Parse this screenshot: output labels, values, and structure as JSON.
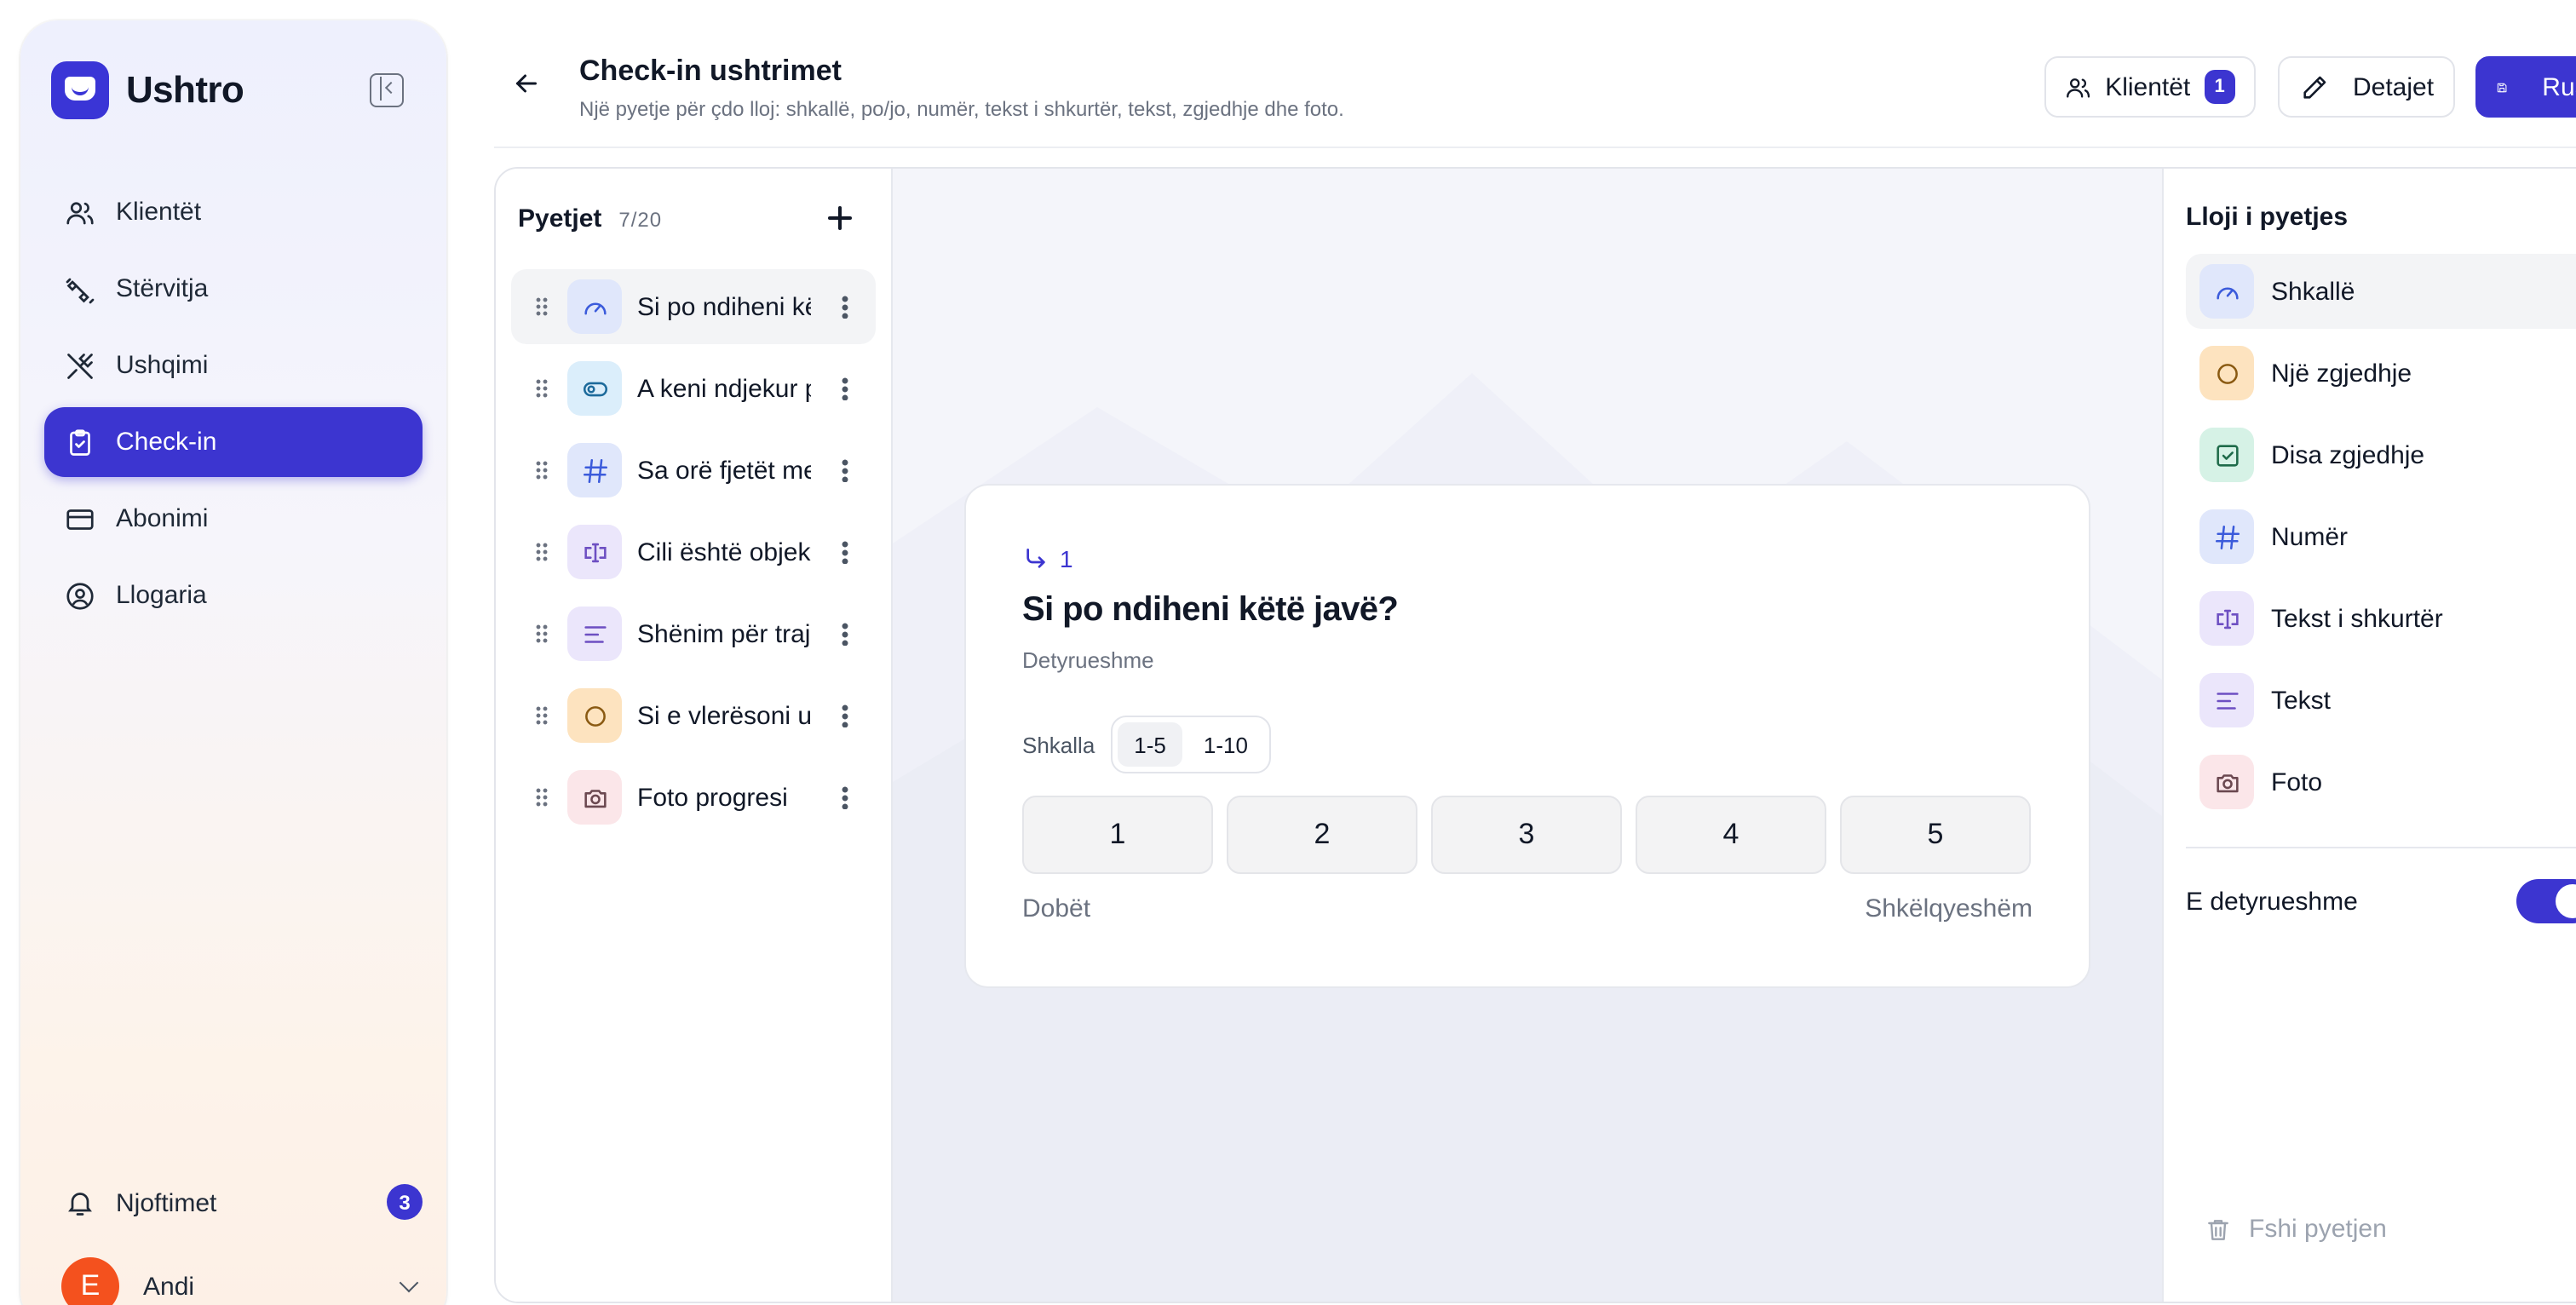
{
  "brand": {
    "name": "Ushtro"
  },
  "sidebar": {
    "items": [
      {
        "label": "Klientët",
        "icon": "users-icon",
        "active": false
      },
      {
        "label": "Stërvitja",
        "icon": "dumbbell-icon",
        "active": false
      },
      {
        "label": "Ushqimi",
        "icon": "utensils-icon",
        "active": false
      },
      {
        "label": "Check-in",
        "icon": "clipboard-check-icon",
        "active": true
      },
      {
        "label": "Abonimi",
        "icon": "credit-card-icon",
        "active": false
      },
      {
        "label": "Llogaria",
        "icon": "user-circle-icon",
        "active": false
      }
    ],
    "notifications": {
      "label": "Njoftimet",
      "count": "3"
    },
    "user": {
      "initial": "E",
      "name": "Andi"
    }
  },
  "header": {
    "title": "Check-in ushtrimet",
    "subtitle": "Një pyetje për çdo lloj: shkallë, po/jo, numër, tekst i shkurtër, tekst, zgjedhje dhe foto.",
    "clients_label": "Klientët",
    "clients_count": "1",
    "details_label": "Detajet",
    "save_label": "Ruaj"
  },
  "questions": {
    "title": "Pyetjet",
    "count": "7/20",
    "items": [
      {
        "label": "Si po ndiheni këtë javë?",
        "icon": "gauge-icon",
        "color": "blue",
        "selected": true
      },
      {
        "label": "A keni ndjekur planin?",
        "icon": "toggle-icon",
        "color": "cyan",
        "selected": false
      },
      {
        "label": "Sa orë fjetët mesatarisht?",
        "icon": "hash-icon",
        "color": "blue",
        "selected": false
      },
      {
        "label": "Cili është objektivi?",
        "icon": "text-cursor-icon",
        "color": "purple",
        "selected": false
      },
      {
        "label": "Shënim për trajnerin",
        "icon": "text-align-icon",
        "color": "purple",
        "selected": false
      },
      {
        "label": "Si e vlerësoni ushqimin?",
        "icon": "circle-icon",
        "color": "orange",
        "selected": false
      },
      {
        "label": "Foto progresi",
        "icon": "camera-icon",
        "color": "pink",
        "selected": false
      }
    ]
  },
  "preview": {
    "number": "1",
    "title": "Si po ndiheni këtë javë?",
    "required_label": "Detyrueshme",
    "scale_label": "Shkalla",
    "scale_options": [
      "1-5",
      "1-10"
    ],
    "scale_selected": "1-5",
    "values": [
      "1",
      "2",
      "3",
      "4",
      "5"
    ],
    "low_label": "Dobët",
    "high_label": "Shkëlqyeshëm"
  },
  "types": {
    "title": "Lloji i pyetjes",
    "items": [
      {
        "label": "Shkallë",
        "icon": "gauge-icon",
        "color": "blue",
        "selected": true
      },
      {
        "label": "Një zgjedhje",
        "icon": "circle-icon",
        "color": "orange",
        "selected": false
      },
      {
        "label": "Disa zgjedhje",
        "icon": "checkbox-icon",
        "color": "green",
        "selected": false
      },
      {
        "label": "Numër",
        "icon": "hash-icon",
        "color": "blue",
        "selected": false
      },
      {
        "label": "Tekst i shkurtër",
        "icon": "text-cursor-icon",
        "color": "purple",
        "selected": false
      },
      {
        "label": "Tekst",
        "icon": "text-align-icon",
        "color": "purple",
        "selected": false
      },
      {
        "label": "Foto",
        "icon": "camera-icon",
        "color": "pink",
        "selected": false
      }
    ],
    "required_toggle_label": "E detyrueshme",
    "required_on": true,
    "delete_label": "Fshi pyetjen"
  },
  "colors": {
    "accent": "#3c35d0",
    "avatar": "#f4511e"
  }
}
